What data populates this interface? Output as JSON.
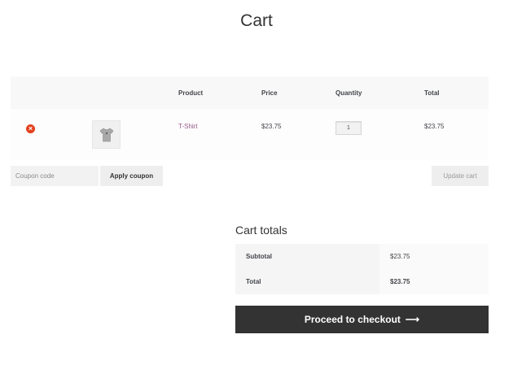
{
  "page": {
    "title": "Cart"
  },
  "cart_table": {
    "headers": {
      "remove": "",
      "thumbnail": "",
      "product": "Product",
      "price": "Price",
      "quantity": "Quantity",
      "total": "Total"
    },
    "rows": [
      {
        "remove_icon": "×",
        "thumbnail_icon": "tshirt-icon",
        "product": "T-Shirt",
        "price": "$23.75",
        "quantity": "1",
        "total": "$23.75"
      }
    ]
  },
  "actions": {
    "coupon_placeholder": "Coupon code",
    "apply_coupon": "Apply coupon",
    "update_cart": "Update cart"
  },
  "cart_totals": {
    "title": "Cart totals",
    "subtotal_label": "Subtotal",
    "subtotal_value": "$23.75",
    "total_label": "Total",
    "total_value": "$23.75"
  },
  "checkout": {
    "label": "Proceed to checkout",
    "arrow": "⟶"
  },
  "colors": {
    "accent": "#96588a",
    "remove": "#e2401c",
    "button_dark": "#333333"
  }
}
